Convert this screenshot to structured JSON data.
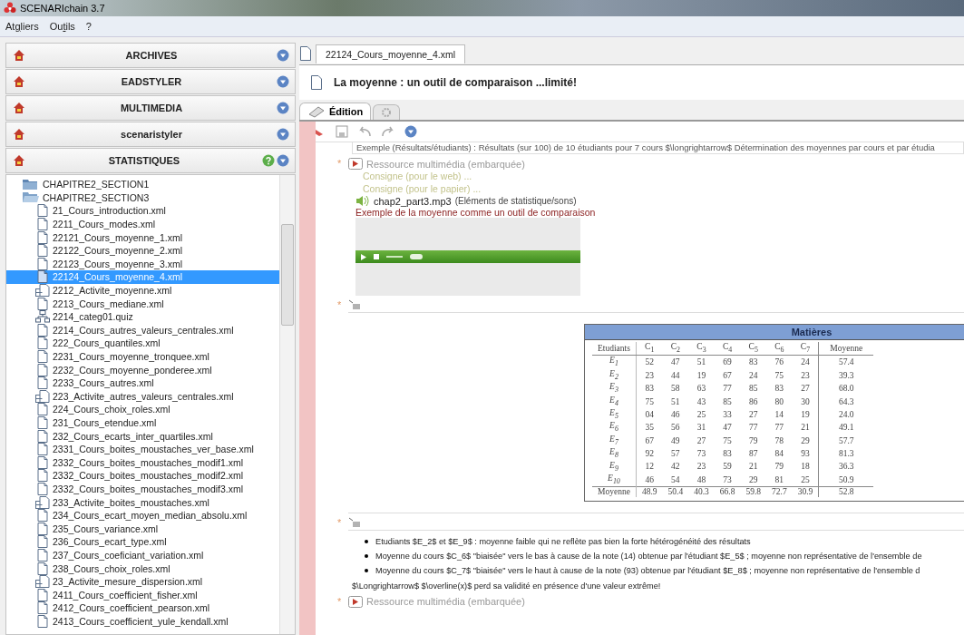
{
  "window": {
    "title": "SCENARIchain 3.7"
  },
  "menu": [
    {
      "label": "At**g**liers"
    },
    {
      "label": "Ou**t**ils"
    },
    {
      "label": "?"
    }
  ],
  "workshops": [
    {
      "label": "ARCHIVES",
      "help": false
    },
    {
      "label": "EADSTYLER",
      "help": false
    },
    {
      "label": "MULTIMEDIA",
      "help": false
    },
    {
      "label": "scenaristyler",
      "help": false
    },
    {
      "label": "STATISTIQUES",
      "help": true
    }
  ],
  "tree": [
    {
      "kind": "folder",
      "label": "CHAPITRE2_SECTION1",
      "expanded": false,
      "selected": false
    },
    {
      "kind": "folder",
      "label": "CHAPITRE2_SECTION3",
      "expanded": true,
      "selected": false,
      "children": [
        {
          "kind": "file",
          "label": "21_Cours_introduction.xml",
          "selected": false
        },
        {
          "kind": "file",
          "label": "2211_Cours_modes.xml",
          "selected": false
        },
        {
          "kind": "file",
          "label": "22121_Cours_moyenne_1.xml",
          "selected": false
        },
        {
          "kind": "file",
          "label": "22122_Cours_moyenne_2.xml",
          "selected": false
        },
        {
          "kind": "file",
          "label": "22123_Cours_moyenne_3.xml",
          "selected": false
        },
        {
          "kind": "file",
          "label": "22124_Cours_moyenne_4.xml",
          "selected": true
        },
        {
          "kind": "activity",
          "label": "2212_Activite_moyenne.xml",
          "selected": false
        },
        {
          "kind": "file",
          "label": "2213_Cours_mediane.xml",
          "selected": false
        },
        {
          "kind": "quiz",
          "label": "2214_categ01.quiz",
          "selected": false
        },
        {
          "kind": "file",
          "label": "2214_Cours_autres_valeurs_centrales.xml",
          "selected": false
        },
        {
          "kind": "file",
          "label": "222_Cours_quantiles.xml",
          "selected": false
        },
        {
          "kind": "file",
          "label": "2231_Cours_moyenne_tronquee.xml",
          "selected": false
        },
        {
          "kind": "file",
          "label": "2232_Cours_moyenne_ponderee.xml",
          "selected": false
        },
        {
          "kind": "file",
          "label": "2233_Cours_autres.xml",
          "selected": false
        },
        {
          "kind": "activity",
          "label": "223_Activite_autres_valeurs_centrales.xml",
          "selected": false
        },
        {
          "kind": "file",
          "label": "224_Cours_choix_roles.xml",
          "selected": false
        },
        {
          "kind": "file",
          "label": "231_Cours_etendue.xml",
          "selected": false
        },
        {
          "kind": "file",
          "label": "232_Cours_ecarts_inter_quartiles.xml",
          "selected": false
        },
        {
          "kind": "file",
          "label": "2331_Cours_boites_moustaches_ver_base.xml",
          "selected": false
        },
        {
          "kind": "file",
          "label": "2332_Cours_boites_moustaches_modif1.xml",
          "selected": false
        },
        {
          "kind": "file",
          "label": "2332_Cours_boites_moustaches_modif2.xml",
          "selected": false
        },
        {
          "kind": "file",
          "label": "2332_Cours_boites_moustaches_modif3.xml",
          "selected": false
        },
        {
          "kind": "activity",
          "label": "233_Activite_boites_moustaches.xml",
          "selected": false
        },
        {
          "kind": "file",
          "label": "234_Cours_ecart_moyen_median_absolu.xml",
          "selected": false
        },
        {
          "kind": "file",
          "label": "235_Cours_variance.xml",
          "selected": false
        },
        {
          "kind": "file",
          "label": "236_Cours_ecart_type.xml",
          "selected": false
        },
        {
          "kind": "file",
          "label": "237_Cours_coeficiant_variation.xml",
          "selected": false
        },
        {
          "kind": "file",
          "label": "238_Cours_choix_roles.xml",
          "selected": false
        },
        {
          "kind": "activity",
          "label": "23_Activite_mesure_dispersion.xml",
          "selected": false
        },
        {
          "kind": "file",
          "label": "2411_Cours_coefficient_fisher.xml",
          "selected": false
        },
        {
          "kind": "file",
          "label": "2412_Cours_coefficient_pearson.xml",
          "selected": false
        },
        {
          "kind": "file",
          "label": "2413_Cours_coefficient_yule_kendall.xml",
          "selected": false
        }
      ]
    }
  ],
  "editor": {
    "tab": "22124_Cours_moyenne_4.xml",
    "title": "La moyenne : un outil de comparaison ...limité!",
    "view_tabs": [
      {
        "label": "Édition",
        "selected": true
      },
      {
        "selected": false
      }
    ],
    "marks": [
      "*",
      "*",
      "*",
      "*"
    ],
    "cut_line": "Exemple (Résultats/étudiants) : Résultats (sur 100) de 10 étudiants pour 7 cours $\\longrightarrow$ Détermination des moyennes par cours et par étudia",
    "resource": {
      "header": "Ressource multimédia (embarquée)",
      "hints": [
        "Consigne (pour le web) ...",
        "Consigne (pour le papier) ..."
      ],
      "file": "chap2_part3.mp3",
      "source": "(Eléments de statistique/sons)",
      "caption": "Exemple de la moyenne comme un outil de comparaison"
    },
    "table": {
      "title": "Matières",
      "columns": [
        "Etudiants",
        "C$_{1}$",
        "C$_{2}$",
        "C$_{3}$",
        "C$_{4}$",
        "C$_{5}$",
        "C$_{6}$",
        "C$_{7}$",
        "Moyenne"
      ],
      "rows": [
        [
          "E$_{1}$",
          "52",
          "47",
          "51",
          "69",
          "83",
          "76",
          "24",
          "57.4"
        ],
        [
          "E$_{2}$",
          "23",
          "44",
          "19",
          "67",
          "24",
          "75",
          "23",
          "39.3"
        ],
        [
          "E$_{3}$",
          "83",
          "58",
          "63",
          "77",
          "85",
          "83",
          "27",
          "68.0"
        ],
        [
          "E$_{4}$",
          "75",
          "51",
          "43",
          "85",
          "86",
          "80",
          "30",
          "64.3"
        ],
        [
          "E$_{5}$",
          "04",
          "46",
          "25",
          "33",
          "27",
          "14",
          "19",
          "24.0"
        ],
        [
          "E$_{6}$",
          "35",
          "56",
          "31",
          "47",
          "77",
          "77",
          "21",
          "49.1"
        ],
        [
          "E$_{7}$",
          "67",
          "49",
          "27",
          "75",
          "79",
          "78",
          "29",
          "57.7"
        ],
        [
          "E$_{8}$",
          "92",
          "57",
          "73",
          "83",
          "87",
          "84",
          "93",
          "81.3"
        ],
        [
          "E$_{9}$",
          "12",
          "42",
          "23",
          "59",
          "21",
          "79",
          "18",
          "36.3"
        ],
        [
          "E$_{10}$",
          "46",
          "54",
          "48",
          "73",
          "29",
          "81",
          "25",
          "50.9"
        ]
      ],
      "footer": [
        "Moyenne",
        "48.9",
        "50.4",
        "40.3",
        "66.8",
        "59.8",
        "72.7",
        "30.9",
        "52.8"
      ]
    },
    "bullets": [
      "Etudiants $E_2$ et $E_9$ : moyenne faible qui ne reflète pas bien la forte hétérogénéité des résultats",
      "Moyenne du cours $C_6$ \"biaisée\" vers le bas à cause de la note (14) obtenue par l'étudiant $E_5$ ; moyenne non représentative de l'ensemble de",
      "Moyenne du cours $C_7$ \"biaisée\" vers le haut à cause de la note (93) obtenue par l'étudiant $E_8$ ; moyenne non représentative de l'ensemble d"
    ],
    "conclusion": "$\\Longrightarrow$ $\\overline(x)$ perd sa validité en présence d'une valeur extrême!",
    "next_resource": "Ressource multimédia (embarquée)"
  }
}
